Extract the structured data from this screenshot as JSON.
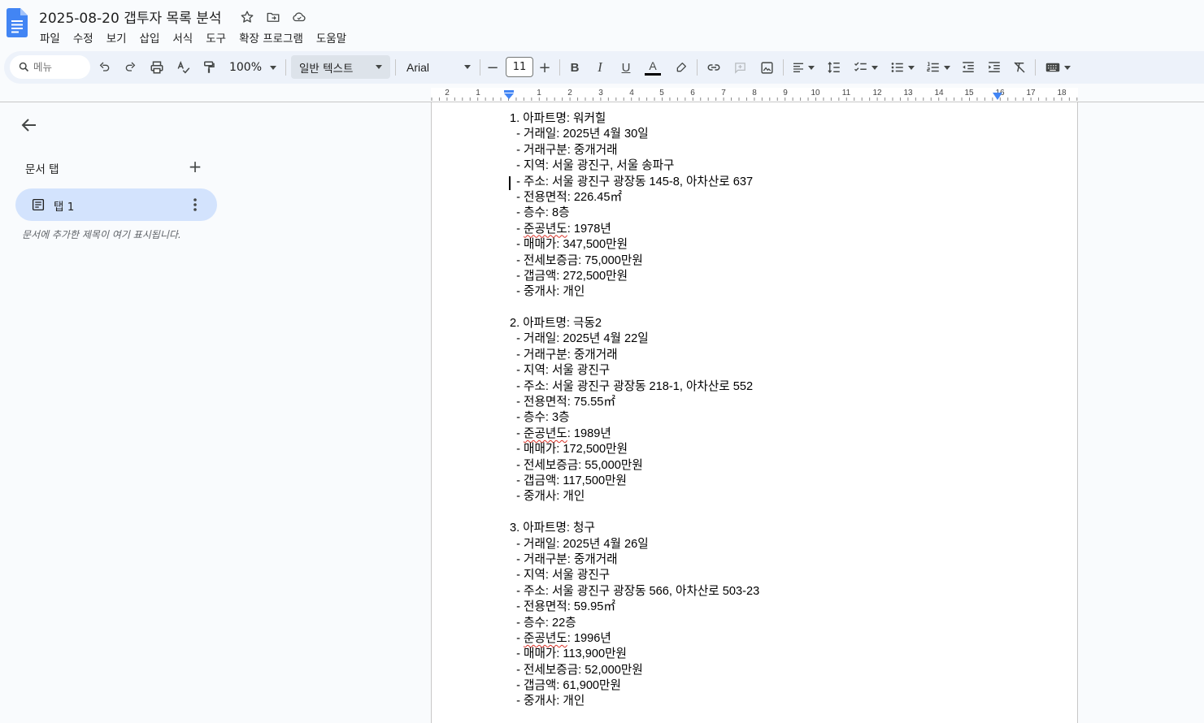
{
  "doc": {
    "title": "2025-08-20 갭투자 목록 분석"
  },
  "menu": [
    "파일",
    "수정",
    "보기",
    "삽입",
    "서식",
    "도구",
    "확장 프로그램",
    "도움말"
  ],
  "toolbar": {
    "search_placeholder": "메뉴",
    "zoom": "100%",
    "style": "일반 텍스트",
    "font": "Arial",
    "font_size": "11",
    "minus": "−",
    "plus": "+",
    "bold": "B",
    "italic": "I",
    "underline": "U",
    "text_color_letter": "A"
  },
  "sidebar": {
    "heading": "문서 탭",
    "tab_label": "탭 1",
    "hint": "문서에 추가한 제목이 여기 표시됩니다."
  },
  "ruler": {
    "numbers": [
      "2",
      "1",
      "1",
      "2",
      "3",
      "4",
      "5",
      "6",
      "7",
      "8",
      "9",
      "10",
      "11",
      "12",
      "13",
      "14",
      "15",
      "16",
      "17",
      "18"
    ]
  },
  "entries": [
    {
      "heading": "1. 아파트명: 워커힐",
      "deal_date": "  - 거래일: 2025년 4월 30일",
      "deal_type": "  - 거래구분: 중개거래",
      "region": "  - 지역: 서울 광진구, 서울 송파구",
      "address": "  - 주소: 서울 광진구 광장동 145-8, 아차산로 637",
      "area": "  - 전용면적: 226.45㎡",
      "floor": "  - 층수: 8층",
      "built_prefix": "  - ",
      "built_word": "준공년도",
      "built_value": ": 1978년",
      "price": "  - 매매가: 347,500만원",
      "deposit": "  - 전세보증금: 75,000만원",
      "gap": "  - 갭금액: 272,500만원",
      "agent": "  - 중개사: 개인"
    },
    {
      "heading": "2. 아파트명: 극동2",
      "deal_date": "  - 거래일: 2025년 4월 22일",
      "deal_type": "  - 거래구분: 중개거래",
      "region": "  - 지역: 서울 광진구",
      "address": "  - 주소: 서울 광진구 광장동 218-1, 아차산로 552",
      "area": "  - 전용면적: 75.55㎡",
      "floor": "  - 층수: 3층",
      "built_prefix": "  - ",
      "built_word": "준공년도",
      "built_value": ": 1989년",
      "price": "  - 매매가: 172,500만원",
      "deposit": "  - 전세보증금: 55,000만원",
      "gap": "  - 갭금액: 117,500만원",
      "agent": "  - 중개사: 개인"
    },
    {
      "heading": "3. 아파트명: 청구",
      "deal_date": "  - 거래일: 2025년 4월 26일",
      "deal_type": "  - 거래구분: 중개거래",
      "region": "  - 지역: 서울 광진구",
      "address": "  - 주소: 서울 광진구 광장동 566, 아차산로 503-23",
      "area": "  - 전용면적: 59.95㎡",
      "floor": "  - 층수: 22층",
      "built_prefix": "  - ",
      "built_word": "준공년도",
      "built_value": ": 1996년",
      "price": "  - 매매가: 113,900만원",
      "deposit": "  - 전세보증금: 52,000만원",
      "gap": "  - 갭금액: 61,900만원",
      "agent": "  - 중개사: 개인"
    }
  ]
}
